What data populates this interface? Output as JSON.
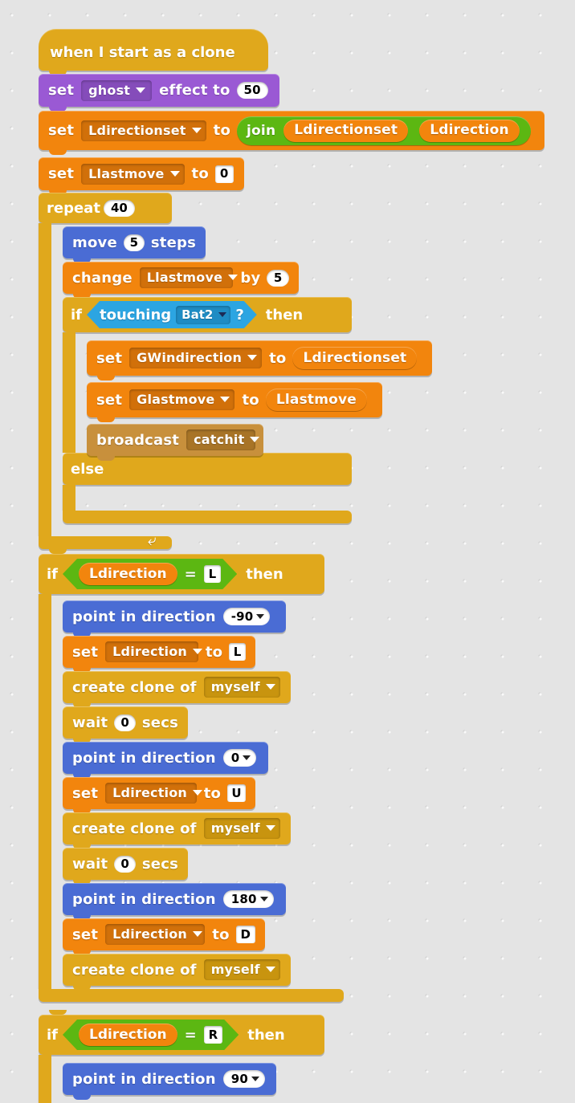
{
  "app": {
    "name": "Scratch Block Editor",
    "canvas_background": "#e4e4e4"
  },
  "palette": {
    "control": "#e0a81c",
    "looks": "#9a59d4",
    "data": "#f2850d",
    "motion": "#4a6cd4",
    "sensing": "#2ca5e2",
    "operators": "#5cb712",
    "events": "#c8903c"
  },
  "script": {
    "hat": {
      "label": "when I start as a clone"
    },
    "set_ghost": {
      "set": "set",
      "effect_name": "ghost",
      "effect_to": "effect to",
      "value": "50"
    },
    "set_ldirectionset": {
      "set": "set",
      "variable": "Ldirectionset",
      "to": "to",
      "join_label": "join",
      "join_arg1": "Ldirectionset",
      "join_arg2": "Ldirection"
    },
    "set_llastmove": {
      "set": "set",
      "variable": "Llastmove",
      "to": "to",
      "value": "0"
    },
    "repeat": {
      "label": "repeat",
      "times": "40",
      "loop_arrow": "↺"
    },
    "move": {
      "label": "move",
      "steps": "5",
      "steps_label": "steps"
    },
    "change": {
      "label": "change",
      "variable": "Llastmove",
      "by": "by",
      "value": "5"
    },
    "if_touching": {
      "if": "if",
      "touching": "touching",
      "target": "Bat2",
      "question": "?",
      "then": "then",
      "else": "else"
    },
    "set_gwindirection": {
      "set": "set",
      "variable": "GWindirection",
      "to": "to",
      "value": "Ldirectionset"
    },
    "set_glastmove": {
      "set": "set",
      "variable": "Glastmove",
      "to": "to",
      "value": "Llastmove"
    },
    "broadcast": {
      "label": "broadcast",
      "message": "catchit"
    },
    "if_left": {
      "if": "if",
      "variable": "Ldirection",
      "operator": "=",
      "compare_value": "L",
      "then": "then"
    },
    "if_left_body": [
      {
        "type": "point",
        "label": "point in direction",
        "value": "-90"
      },
      {
        "type": "set",
        "set": "set",
        "variable": "Ldirection",
        "to": "to",
        "value": "L"
      },
      {
        "type": "clone",
        "label": "create clone of",
        "target": "myself"
      },
      {
        "type": "wait",
        "label": "wait",
        "value": "0",
        "unit": "secs"
      },
      {
        "type": "point",
        "label": "point in direction",
        "value": "0"
      },
      {
        "type": "set",
        "set": "set",
        "variable": "Ldirection",
        "to": "to",
        "value": "U"
      },
      {
        "type": "clone",
        "label": "create clone of",
        "target": "myself"
      },
      {
        "type": "wait",
        "label": "wait",
        "value": "0",
        "unit": "secs"
      },
      {
        "type": "point",
        "label": "point in direction",
        "value": "180"
      },
      {
        "type": "set",
        "set": "set",
        "variable": "Ldirection",
        "to": "to",
        "value": "D"
      },
      {
        "type": "clone",
        "label": "create clone of",
        "target": "myself"
      }
    ],
    "if_right": {
      "if": "if",
      "variable": "Ldirection",
      "operator": "=",
      "compare_value": "R",
      "then": "then"
    },
    "if_right_body": [
      {
        "type": "point",
        "label": "point in direction",
        "value": "90"
      }
    ]
  }
}
